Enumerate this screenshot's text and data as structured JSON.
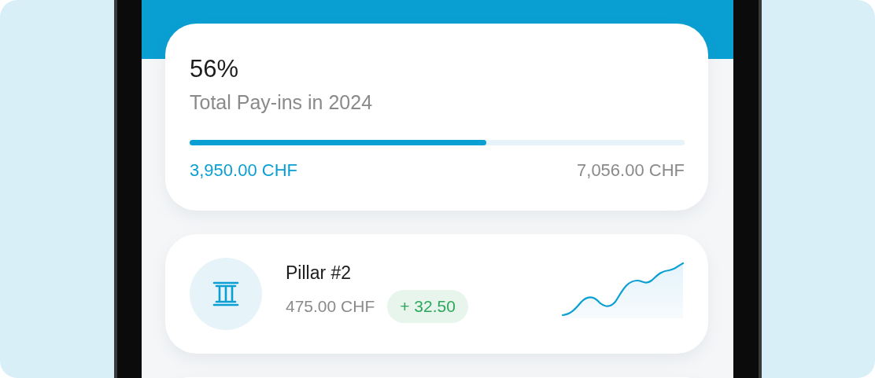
{
  "summary_card": {
    "percentage": "56%",
    "label": "Total Pay-ins in 2024",
    "progress": {
      "level": 0.6
    },
    "current_amount": "3,950.00 CHF",
    "target_amount": "7,056.00 CHF"
  },
  "accounts": [
    {
      "name": "Pillar #2",
      "amount": "475.00 CHF",
      "change": "+ 32.50"
    }
  ]
}
